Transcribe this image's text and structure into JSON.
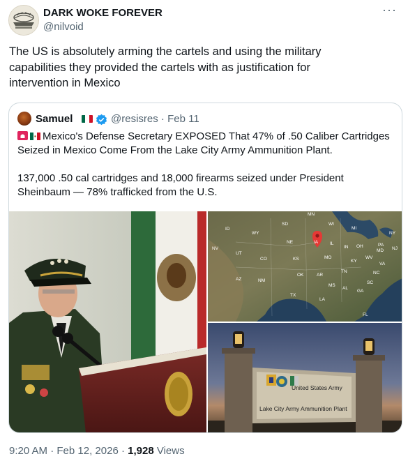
{
  "author": {
    "name": "DARK WOKE FOREVER",
    "handle": "@nilvoid"
  },
  "more_label": "···",
  "text": "The US is absolutely arming the cartels and using the military capabilities they provided the cartels with as justification for intervention in Mexico",
  "quote": {
    "name": "Samuel",
    "handle": "@resisres",
    "date": "· Feb 11",
    "line1": "Mexico's Defense Secretary EXPOSED That 47% of .50 Caliber Cartridges Seized in Mexico Come From the Lake City Army Ammunition Plant.",
    "line2": "137,000 .50 cal cartridges and 18,000 firearms seized under President Sheinbaum — 78% trafficked from the U.S."
  },
  "map": {
    "labels": [
      "MN",
      "SD",
      "WI",
      "MI",
      "NY",
      "ID",
      "WY",
      "NE",
      "IA",
      "IL",
      "IN",
      "OH",
      "PA",
      "MD",
      "NJ",
      "NV",
      "UT",
      "CO",
      "KS",
      "MO",
      "KY",
      "WV",
      "VA",
      "TN",
      "NC",
      "AZ",
      "NM",
      "OK",
      "AR",
      "SC",
      "MS",
      "AL",
      "GA",
      "TX",
      "LA",
      "FL"
    ]
  },
  "sign": {
    "line1": "United States Army",
    "line2": "Lake City Army Ammunition Plant"
  },
  "footer": {
    "time": "9:20 AM",
    "sep1": " · ",
    "date": "Feb 12, 2026",
    "sep2": " · ",
    "views": "1,928",
    "views_label": " Views"
  },
  "colors": {
    "accent": "#1d9bf0",
    "secondary_text": "#536471",
    "border": "#cfd9de"
  }
}
